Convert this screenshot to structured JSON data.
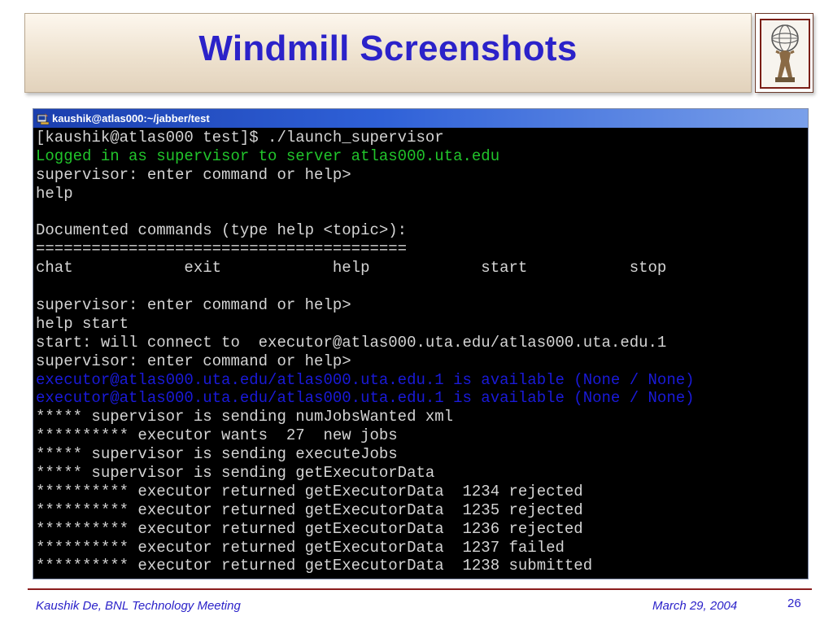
{
  "slide": {
    "title": "Windmill Screenshots",
    "footer_left": "Kaushik De, BNL Technology Meeting",
    "footer_date": "March 29, 2004",
    "page_number": "26",
    "logo_icon": "atlas-globe-icon"
  },
  "terminal": {
    "window_title": "kaushik@atlas000:~/jabber/test",
    "icon": "terminal-icon",
    "colors": {
      "text": "#d4d4d4",
      "green": "#21c42b",
      "blue": "#1a1ad9",
      "background": "#000000"
    },
    "lines": [
      {
        "text": "[kaushik@atlas000 test]$ ./launch_supervisor",
        "color": "white"
      },
      {
        "text": "Logged in as supervisor to server atlas000.uta.edu",
        "color": "green"
      },
      {
        "text": "supervisor: enter command or help>",
        "color": "white"
      },
      {
        "text": "help",
        "color": "white"
      },
      {
        "text": "",
        "color": "white"
      },
      {
        "text": "Documented commands (type help <topic>):",
        "color": "white"
      },
      {
        "text": "========================================",
        "color": "white"
      },
      {
        "text": "chat            exit            help            start           stop",
        "color": "white"
      },
      {
        "text": "",
        "color": "white"
      },
      {
        "text": "supervisor: enter command or help>",
        "color": "white"
      },
      {
        "text": "help start",
        "color": "white"
      },
      {
        "text": "start: will connect to  executor@atlas000.uta.edu/atlas000.uta.edu.1",
        "color": "white"
      },
      {
        "text": "supervisor: enter command or help>",
        "color": "white"
      },
      {
        "text": "executor@atlas000.uta.edu/atlas000.uta.edu.1 is available (None / None)",
        "color": "blue"
      },
      {
        "text": "executor@atlas000.uta.edu/atlas000.uta.edu.1 is available (None / None)",
        "color": "blue"
      },
      {
        "text": "***** supervisor is sending numJobsWanted xml",
        "color": "white"
      },
      {
        "text": "********** executor wants  27  new jobs",
        "color": "white"
      },
      {
        "text": "***** supervisor is sending executeJobs",
        "color": "white"
      },
      {
        "text": "***** supervisor is sending getExecutorData",
        "color": "white"
      },
      {
        "text": "********** executor returned getExecutorData  1234 rejected",
        "color": "white"
      },
      {
        "text": "********** executor returned getExecutorData  1235 rejected",
        "color": "white"
      },
      {
        "text": "********** executor returned getExecutorData  1236 rejected",
        "color": "white"
      },
      {
        "text": "********** executor returned getExecutorData  1237 failed",
        "color": "white"
      },
      {
        "text": "********** executor returned getExecutorData  1238 submitted",
        "color": "white"
      }
    ]
  }
}
